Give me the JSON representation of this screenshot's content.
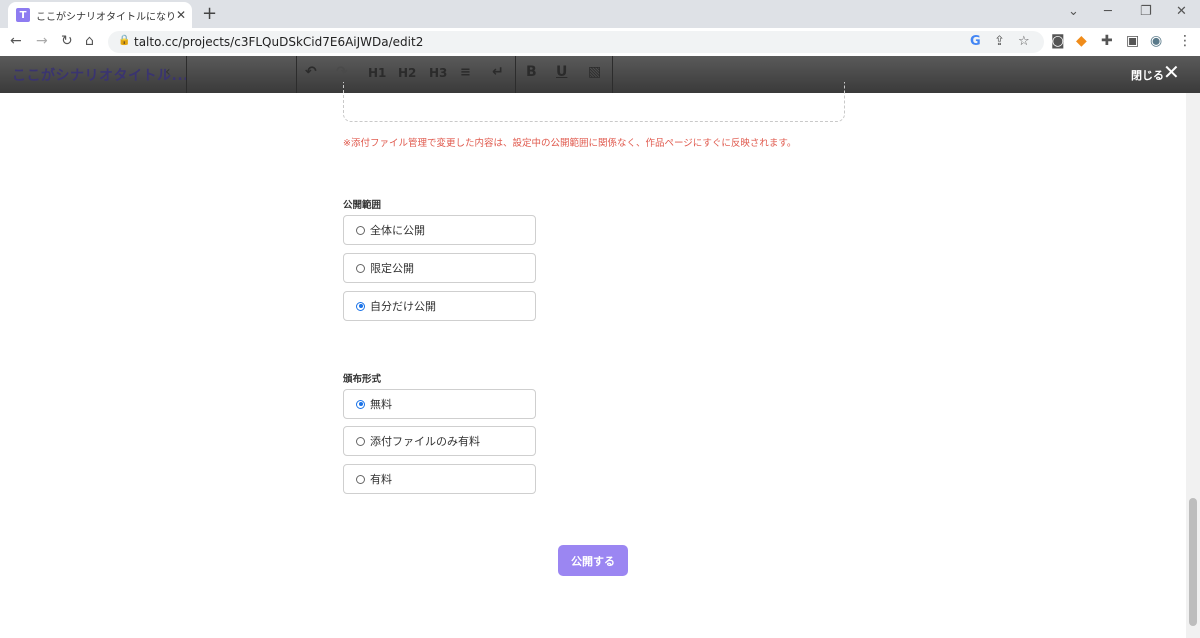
{
  "browser": {
    "tab_title": "ここがシナリオタイトルになります。- TA",
    "favicon_letter": "T",
    "url": "talto.cc/projects/c3FLQuDSkCid7E6AiJWDa/edit2",
    "google_icon": "G"
  },
  "toolbar": {
    "doc_title": "ここがシナリオタイトル...",
    "h1": "H1",
    "h2": "H2",
    "h3": "H3",
    "bold": "B",
    "underline": "U",
    "close_label": "閉じる"
  },
  "attachments": {
    "note": "※添付ファイル管理で変更した内容は、設定中の公開範囲に関係なく、作品ページにすぐに反映されます。"
  },
  "visibility": {
    "label": "公開範囲",
    "options": [
      {
        "label": "全体に公開",
        "checked": false
      },
      {
        "label": "限定公開",
        "checked": false
      },
      {
        "label": "自分だけ公開",
        "checked": true
      }
    ]
  },
  "distribution": {
    "label": "頒布形式",
    "options": [
      {
        "label": "無料",
        "checked": true
      },
      {
        "label": "添付ファイルのみ有料",
        "checked": false
      },
      {
        "label": "有料",
        "checked": false
      }
    ]
  },
  "publish_button": "公開する",
  "colors": {
    "accent": "#9b86f2",
    "note_red": "#e05a4e",
    "radio_blue": "#1a73e8"
  }
}
